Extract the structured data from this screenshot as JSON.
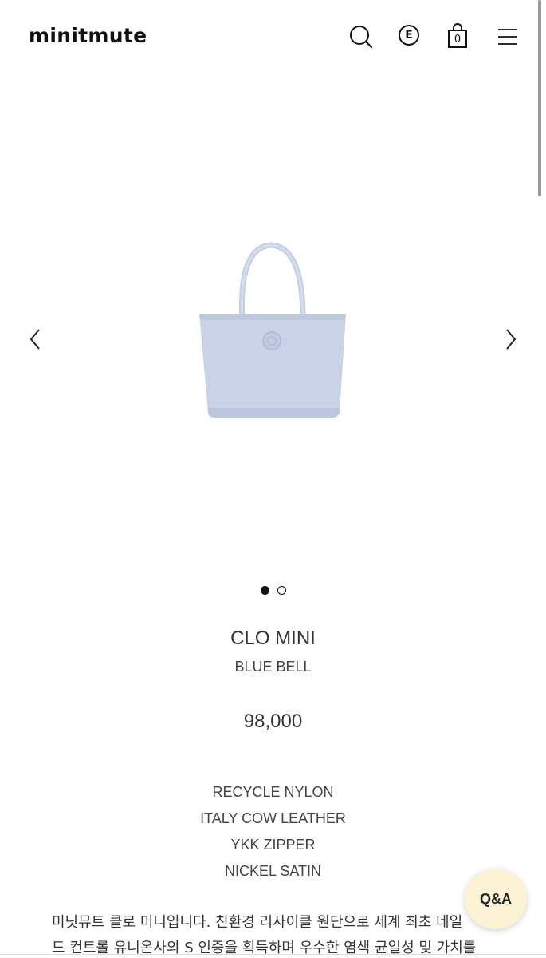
{
  "header": {
    "logo": "minitmute",
    "cart_count": "0",
    "e_icon_letter": "E",
    "icons": [
      "search-icon",
      "e-icon",
      "shopping-bag-icon",
      "menu-icon"
    ]
  },
  "gallery": {
    "image_name": "clo-mini-blue-bell-tote",
    "slide_count": 2,
    "active_slide": 1,
    "prev_icon": "chevron-left-icon",
    "next_icon": "chevron-right-icon"
  },
  "product": {
    "name": "CLO MINI",
    "color": "BLUE BELL",
    "price": "98,000",
    "materials": [
      "RECYCLE NYLON",
      "ITALY COW LEATHER",
      "YKK ZIPPER",
      "NICKEL SATIN"
    ],
    "description": [
      "미닛뮤트 클로 미니입니다. 친환경 리사이클 원단으로 세계 최초 네일",
      "드 컨트롤 유니온사의 S 인증을 획득하며 우수한 염색 균일성 및 가치를"
    ]
  },
  "qa_button": {
    "label": "Q&A"
  },
  "colors": {
    "bag_fill": "#c9d2e6",
    "bag_shadow": "#b6c0d8",
    "qa_bg": "#fbf3d4",
    "text": "#333333"
  }
}
